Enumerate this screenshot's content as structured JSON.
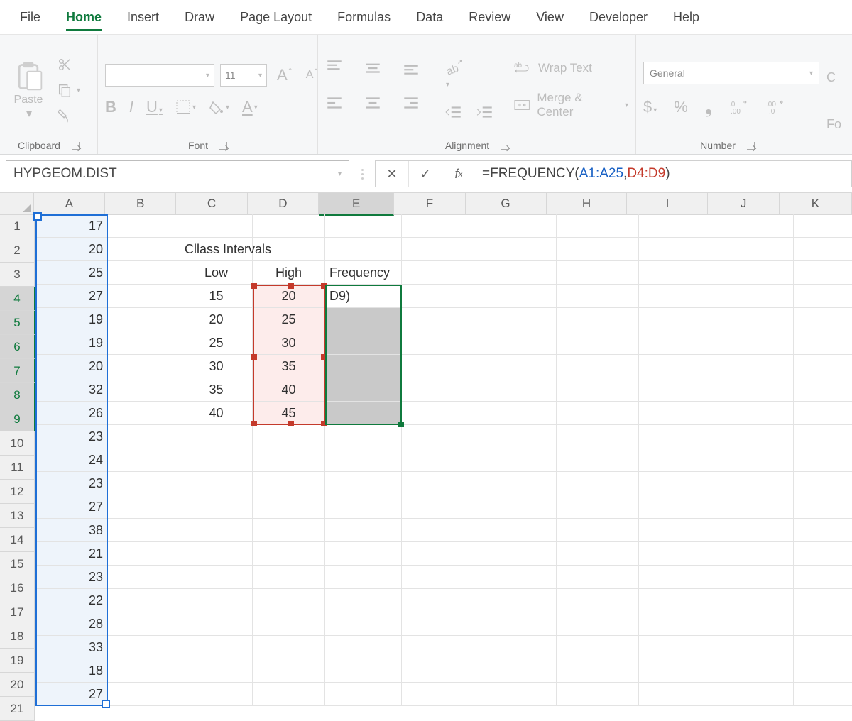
{
  "tabs": {
    "file": "File",
    "home": "Home",
    "insert": "Insert",
    "draw": "Draw",
    "pagelayout": "Page Layout",
    "formulas": "Formulas",
    "data": "Data",
    "review": "Review",
    "view": "View",
    "developer": "Developer",
    "help": "Help",
    "active": "home"
  },
  "ribbon": {
    "clipboard": {
      "paste": "Paste",
      "label": "Clipboard"
    },
    "font": {
      "size": "11",
      "incA": "A",
      "decA": "A",
      "bold": "B",
      "italic": "I",
      "underline": "U",
      "label": "Font"
    },
    "alignment": {
      "wrap": "Wrap Text",
      "merge": "Merge & Center",
      "label": "Alignment"
    },
    "number": {
      "format": "General",
      "label": "Number",
      "dollar": "$",
      "percent": "%",
      "comma": "❟"
    },
    "cfrag": {
      "top": "C",
      "bottom": "Fo"
    }
  },
  "namebox": "HYPGEOM.DIST",
  "formula": {
    "prefix": "=FREQUENCY(",
    "range1": "A1:A25",
    "comma": ",",
    "range2": "D4:D9",
    "suffix": ")"
  },
  "columns": [
    "A",
    "B",
    "C",
    "D",
    "E",
    "F",
    "G",
    "H",
    "I",
    "J",
    "K"
  ],
  "colWidths": [
    "wA",
    "wB",
    "wC",
    "wD",
    "wE",
    "wF",
    "wG",
    "wH",
    "wI",
    "wJ",
    "wK"
  ],
  "rows": 21,
  "activeCol": "E",
  "activeRows": [
    4,
    5,
    6,
    7,
    8,
    9
  ],
  "dataA": [
    17,
    20,
    25,
    27,
    19,
    19,
    20,
    32,
    26,
    23,
    24,
    23,
    27,
    38,
    21,
    23,
    22,
    28,
    33,
    18,
    27
  ],
  "c2": "Cllass Intervals",
  "c3": "Low",
  "d3": "High",
  "e3": "Frequency",
  "e4": "D9)",
  "lows": [
    15,
    20,
    25,
    30,
    35,
    40
  ],
  "highs": [
    20,
    25,
    30,
    35,
    40,
    45
  ]
}
